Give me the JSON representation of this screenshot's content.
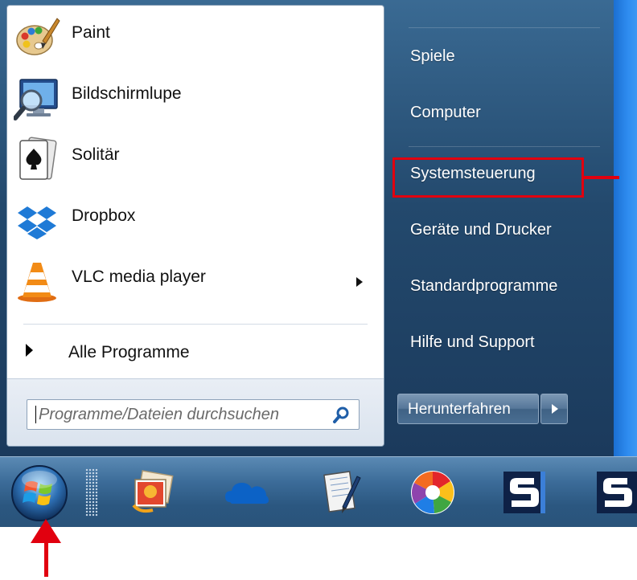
{
  "start_menu": {
    "programs": [
      {
        "label": "Paint",
        "icon": "paint-icon"
      },
      {
        "label": "Bildschirmlupe",
        "icon": "magnifier-icon"
      },
      {
        "label": "Solitär",
        "icon": "solitaire-icon"
      },
      {
        "label": "Dropbox",
        "icon": "dropbox-icon"
      },
      {
        "label": "VLC media player",
        "icon": "vlc-icon",
        "has_submenu": true
      }
    ],
    "all_programs_label": "Alle Programme",
    "search": {
      "placeholder": "Programme/Dateien durchsuchen",
      "icon": "search-icon"
    },
    "right_items": [
      {
        "label": "Spiele"
      },
      {
        "label": "Computer"
      },
      {
        "label": "Systemsteuerung",
        "highlighted": true
      },
      {
        "label": "Geräte und Drucker"
      },
      {
        "label": "Standardprogramme"
      },
      {
        "label": "Hilfe und Support"
      }
    ],
    "shutdown_label": "Herunterfahren"
  },
  "taskbar": {
    "start_button_icon": "windows-start-orb-icon",
    "pinned_icons": [
      "photo-gallery-icon",
      "onedrive-cloud-icon",
      "notepad-pen-icon",
      "picasa-icon",
      "screenpresso-icon",
      "screenpresso-icon-2"
    ]
  },
  "annotation": {
    "color": "#e1000f"
  }
}
